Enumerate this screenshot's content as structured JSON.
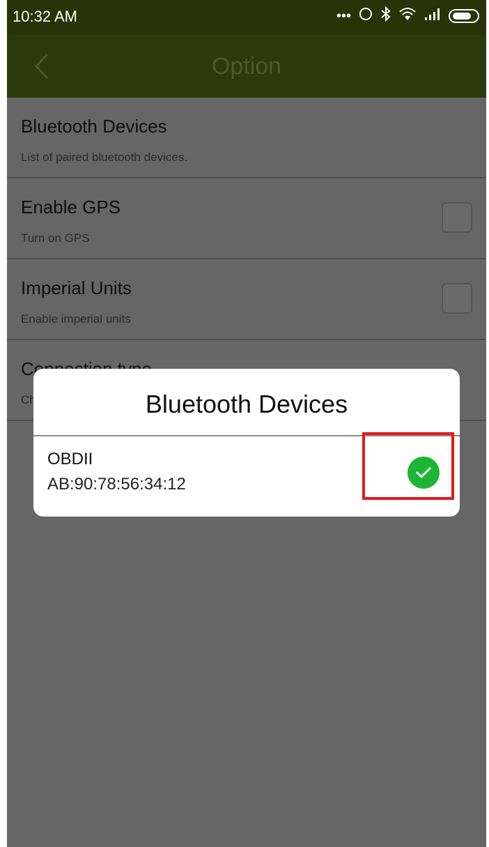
{
  "status_bar": {
    "time": "10:32 AM",
    "icons": [
      "more-dots-icon",
      "sync-icon",
      "bluetooth-icon",
      "wifi-icon",
      "signal-icon",
      "battery-icon"
    ]
  },
  "app_bar": {
    "title": "Option",
    "back_icon": "chevron-left-icon"
  },
  "settings": [
    {
      "title": "Bluetooth Devices",
      "summary": "List of paired bluetooth devices.",
      "has_checkbox": false
    },
    {
      "title": "Enable GPS",
      "summary": "Turn on GPS",
      "has_checkbox": true,
      "checked": false
    },
    {
      "title": "Imperial Units",
      "summary": "Enable imperial units",
      "has_checkbox": true,
      "checked": false
    },
    {
      "title": "Connection type",
      "summary": "Ch",
      "has_checkbox": false
    }
  ],
  "dialog": {
    "title": "Bluetooth Devices",
    "devices": [
      {
        "name": "OBDII",
        "mac": "AB:90:78:56:34:12",
        "selected": true
      }
    ]
  },
  "colors": {
    "status_bar": "#283407",
    "app_bar": "#2b3a0a",
    "scrim_background": "#666666",
    "check_green": "#1cb534",
    "highlight_red": "#e11b1b"
  }
}
